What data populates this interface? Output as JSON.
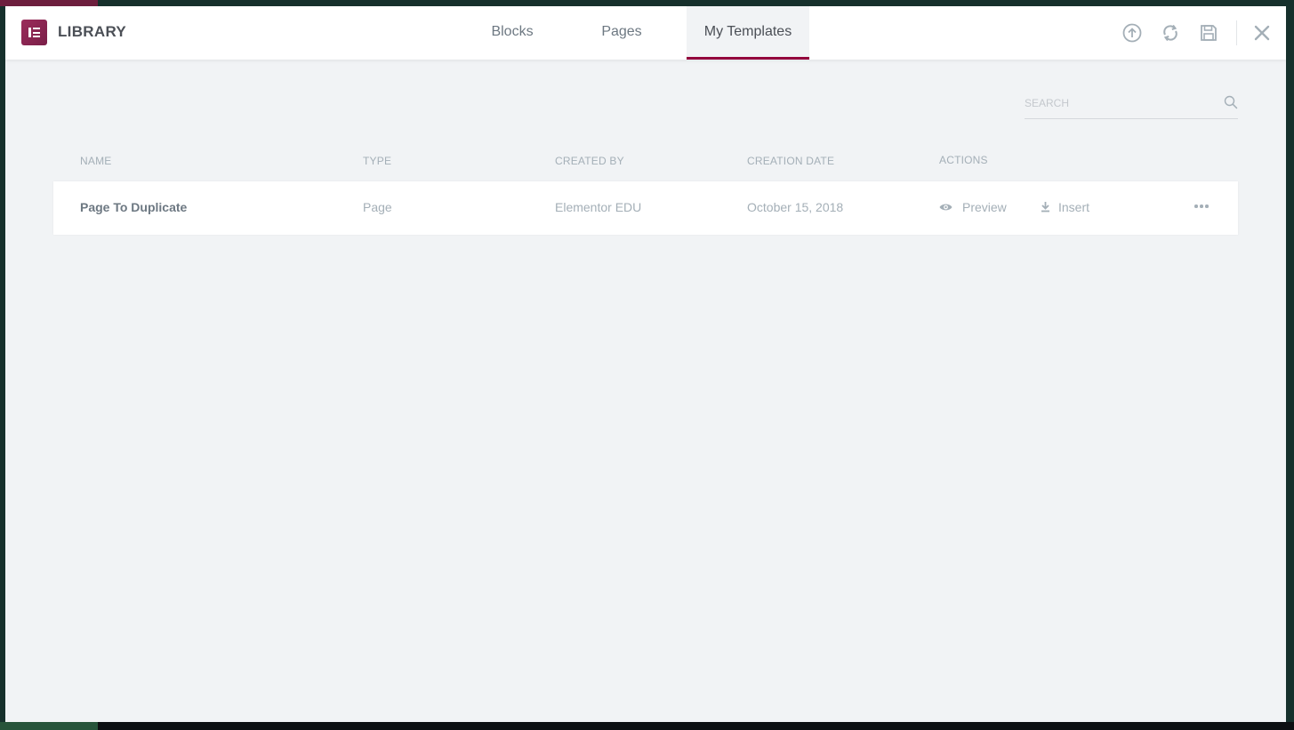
{
  "header": {
    "title": "LIBRARY",
    "tabs": [
      {
        "label": "Blocks",
        "active": false
      },
      {
        "label": "Pages",
        "active": false
      },
      {
        "label": "My Templates",
        "active": true
      }
    ],
    "icons": [
      "import-icon",
      "sync-icon",
      "save-icon",
      "close-icon"
    ]
  },
  "search": {
    "placeholder": "SEARCH",
    "value": ""
  },
  "table": {
    "columns": [
      "NAME",
      "TYPE",
      "CREATED BY",
      "CREATION DATE",
      "ACTIONS"
    ],
    "rows": [
      {
        "name": "Page To Duplicate",
        "type": "Page",
        "created_by": "Elementor EDU",
        "creation_date": "October 15, 2018",
        "actions": {
          "preview": "Preview",
          "insert": "Insert"
        }
      }
    ]
  },
  "colors": {
    "accent": "#93003c",
    "logo": "#9b2c5b",
    "header_bg": "#ffffff",
    "body_bg": "#f1f3f5",
    "muted_text": "#a4afb7",
    "text": "#6d7882"
  }
}
